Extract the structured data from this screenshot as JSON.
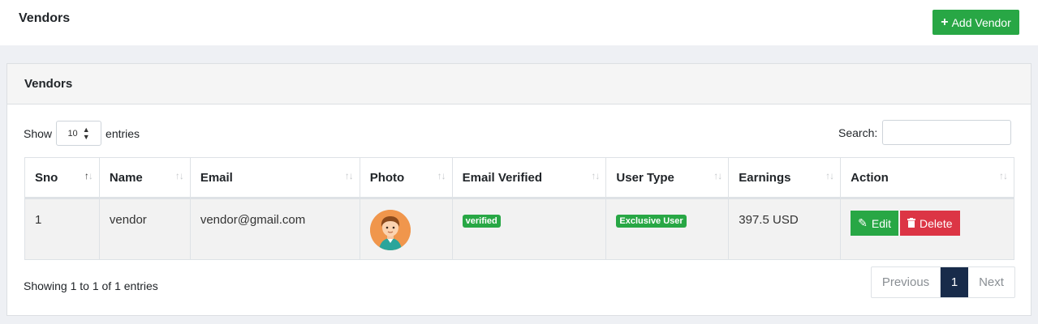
{
  "header": {
    "title": "Vendors",
    "add_button_label": "Add Vendor",
    "add_icon": "plus-icon"
  },
  "card": {
    "title": "Vendors",
    "show_label": "Show",
    "page_length": "10",
    "entries_label": "entries",
    "search_label": "Search:",
    "search_value": ""
  },
  "table": {
    "columns": [
      "Sno",
      "Name",
      "Email",
      "Photo",
      "Email Verified",
      "User Type",
      "Earnings",
      "Action"
    ],
    "rows": [
      {
        "sno": "1",
        "name": "vendor",
        "email": "vendor@gmail.com",
        "photo": "avatar-icon",
        "email_verified": "verified",
        "user_type": "Exclusive User",
        "earnings": "397.5 USD",
        "edit_label": "Edit",
        "delete_label": "Delete"
      }
    ]
  },
  "footer": {
    "info": "Showing 1 to 1 of 1 entries",
    "prev_label": "Previous",
    "current_page": "1",
    "next_label": "Next"
  },
  "colors": {
    "success": "#28a745",
    "danger": "#dc3545",
    "active_page": "#182b4a"
  }
}
